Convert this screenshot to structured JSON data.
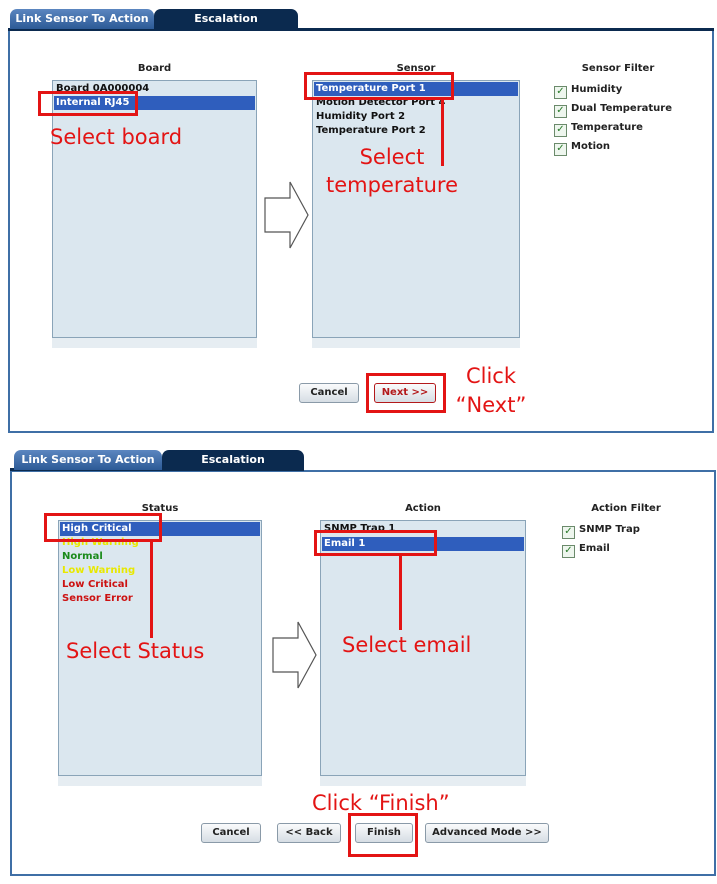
{
  "panel1": {
    "tabs": [
      {
        "label": "Link Sensor To Action"
      },
      {
        "label": "Escalation"
      }
    ],
    "board": {
      "title": "Board",
      "items": [
        {
          "label": "Board 0A000004"
        },
        {
          "label": "Internal RJ45"
        }
      ]
    },
    "sensor": {
      "title": "Sensor",
      "items": [
        {
          "label": "Temperature Port 1"
        },
        {
          "label": "Motion Detector Port 4"
        },
        {
          "label": "Humidity Port 2"
        },
        {
          "label": "Temperature Port 2"
        }
      ]
    },
    "filter": {
      "title": "Sensor Filter",
      "items": [
        {
          "label": "Humidity",
          "checked": true
        },
        {
          "label": "Dual Temperature",
          "checked": true
        },
        {
          "label": "Temperature",
          "checked": true
        },
        {
          "label": "Motion",
          "checked": true
        }
      ]
    },
    "buttons": {
      "cancel": "Cancel",
      "next": "Next >>"
    },
    "annotations": {
      "select_board": "Select board",
      "select_temperature_1": "Select",
      "select_temperature_2": "temperature",
      "click_next_1": "Click",
      "click_next_2": "“Next”"
    }
  },
  "panel2": {
    "tabs": [
      {
        "label": "Link Sensor To Action"
      },
      {
        "label": "Escalation"
      }
    ],
    "status": {
      "title": "Status",
      "items": [
        {
          "label": "High Critical",
          "color": "#ffffff"
        },
        {
          "label": "High Warning",
          "color": "#e8e800"
        },
        {
          "label": "Normal",
          "color": "#1a8a1a"
        },
        {
          "label": "Low Warning",
          "color": "#e8e800"
        },
        {
          "label": "Low Critical",
          "color": "#cc1111"
        },
        {
          "label": "Sensor Error",
          "color": "#cc1111"
        }
      ]
    },
    "action": {
      "title": "Action",
      "items": [
        {
          "label": "SNMP Trap 1"
        },
        {
          "label": "Email 1"
        }
      ]
    },
    "filter": {
      "title": "Action Filter",
      "items": [
        {
          "label": "SNMP Trap",
          "checked": true
        },
        {
          "label": "Email",
          "checked": true
        }
      ]
    },
    "buttons": {
      "cancel": "Cancel",
      "back": "<< Back",
      "finish": "Finish",
      "advanced": "Advanced Mode >>"
    },
    "annotations": {
      "select_status": "Select Status",
      "select_email": "Select email",
      "click_finish": "Click “Finish”"
    }
  },
  "colors": {
    "annotation": "#e31414",
    "tab_dark": "#0b2a4f",
    "selection": "#2f5ebd",
    "list_bg": "#dbe7ef"
  },
  "icons": {
    "arrow": "right-arrow-icon",
    "checkbox": "checkmark-icon"
  }
}
